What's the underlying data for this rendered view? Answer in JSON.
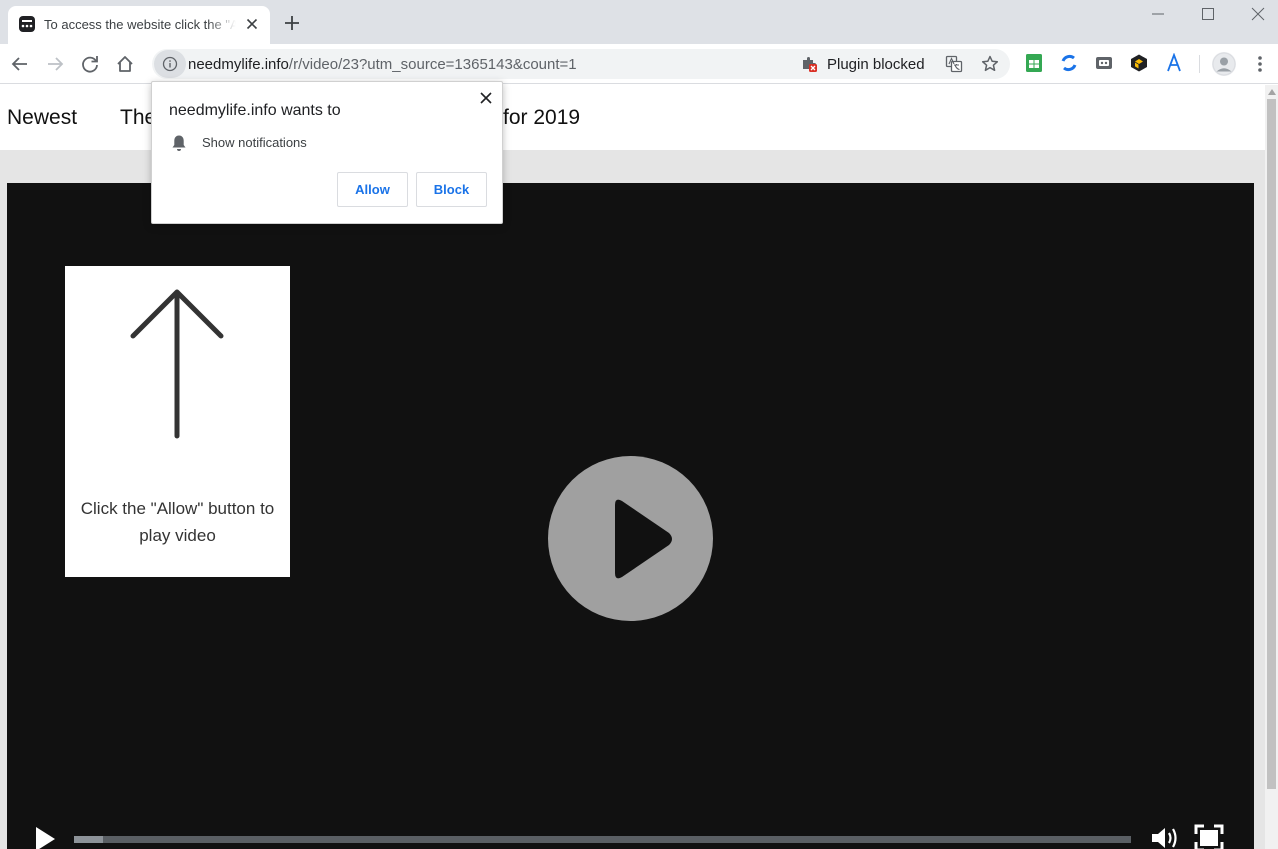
{
  "browser": {
    "tab": {
      "title": "To access the website click the \"Allow\" button",
      "favicon": "message-icon"
    },
    "address_bar": {
      "host": "needmylife.info",
      "path": "/r/video/23?utm_source=1365143&count=1"
    },
    "plugin_status": "Plugin blocked",
    "extension_icons": [
      "sheets-icon",
      "sync-icon",
      "cast-icon",
      "cube-icon",
      "font-a-icon"
    ]
  },
  "page": {
    "nav": {
      "item_1": "Newest",
      "item_2_left": "The",
      "item_2_right": "for 2019"
    },
    "video": {
      "card_text": "Click the \"Allow\" button to play video",
      "progress_fraction": 0.027
    }
  },
  "permission_popup": {
    "title": "needmylife.info wants to",
    "permission": "Show notifications",
    "allow_label": "Allow",
    "block_label": "Block"
  },
  "colors": {
    "tabstrip": "#dee1e6",
    "link_blue": "#1a73e8",
    "video_bg": "#111111",
    "play_circle": "#a0a0a0"
  }
}
